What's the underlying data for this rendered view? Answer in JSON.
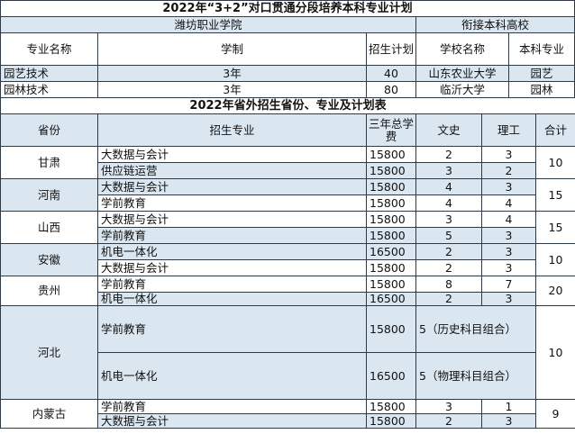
{
  "t1": {
    "title": "2022年“3+2”对口贯通分段培养本科专业计划",
    "school_left": "潍坊职业学院",
    "school_right": "衔接本科高校",
    "headers": [
      "专业名称",
      "学制",
      "招生计划",
      "学校名称",
      "本科专业"
    ],
    "rows": [
      [
        "园艺技术",
        "3年",
        "40",
        "山东农业大学",
        "园艺"
      ],
      [
        "园林技术",
        "3年",
        "80",
        "临沂大学",
        "园林"
      ]
    ]
  },
  "t2": {
    "title": "2022年省外招生省份、专业及计划表",
    "headers": [
      "省份",
      "招生专业",
      "三年总学费",
      "文史",
      "理工",
      "合计"
    ],
    "groups": [
      {
        "province": "甘肃",
        "total": "10",
        "rows": [
          [
            "大数据与会计",
            "15800",
            "2",
            "3"
          ],
          [
            "供应链运营",
            "15800",
            "3",
            "2"
          ]
        ]
      },
      {
        "province": "河南",
        "total": "15",
        "rows": [
          [
            "大数据与会计",
            "15800",
            "4",
            "3"
          ],
          [
            "学前教育",
            "15800",
            "4",
            "4"
          ]
        ]
      },
      {
        "province": "山西",
        "total": "15",
        "rows": [
          [
            "大数据与会计",
            "15800",
            "3",
            "4"
          ],
          [
            "学前教育",
            "15800",
            "5",
            "3"
          ]
        ]
      },
      {
        "province": "安徽",
        "total": "10",
        "rows": [
          [
            "机电一体化",
            "16500",
            "2",
            "3"
          ],
          [
            "大数据与会计",
            "15800",
            "2",
            "3"
          ]
        ]
      },
      {
        "province": "贵州",
        "total": "20",
        "rows": [
          [
            "学前教育",
            "15800",
            "8",
            "7"
          ],
          [
            "机电一体化",
            "16500",
            "2",
            "3"
          ]
        ]
      },
      {
        "province": "河北",
        "total": "10",
        "rows": [
          [
            "学前教育",
            "15800",
            "5（历史科目组合）"
          ],
          [
            "机电一体化",
            "16500",
            "5（物理科目组合）"
          ]
        ]
      },
      {
        "province": "内蒙古",
        "total": "9",
        "rows": [
          [
            "学前教育",
            "15800",
            "3",
            "1"
          ],
          [
            "大数据与会计",
            "15800",
            "2",
            "3"
          ]
        ]
      }
    ]
  }
}
